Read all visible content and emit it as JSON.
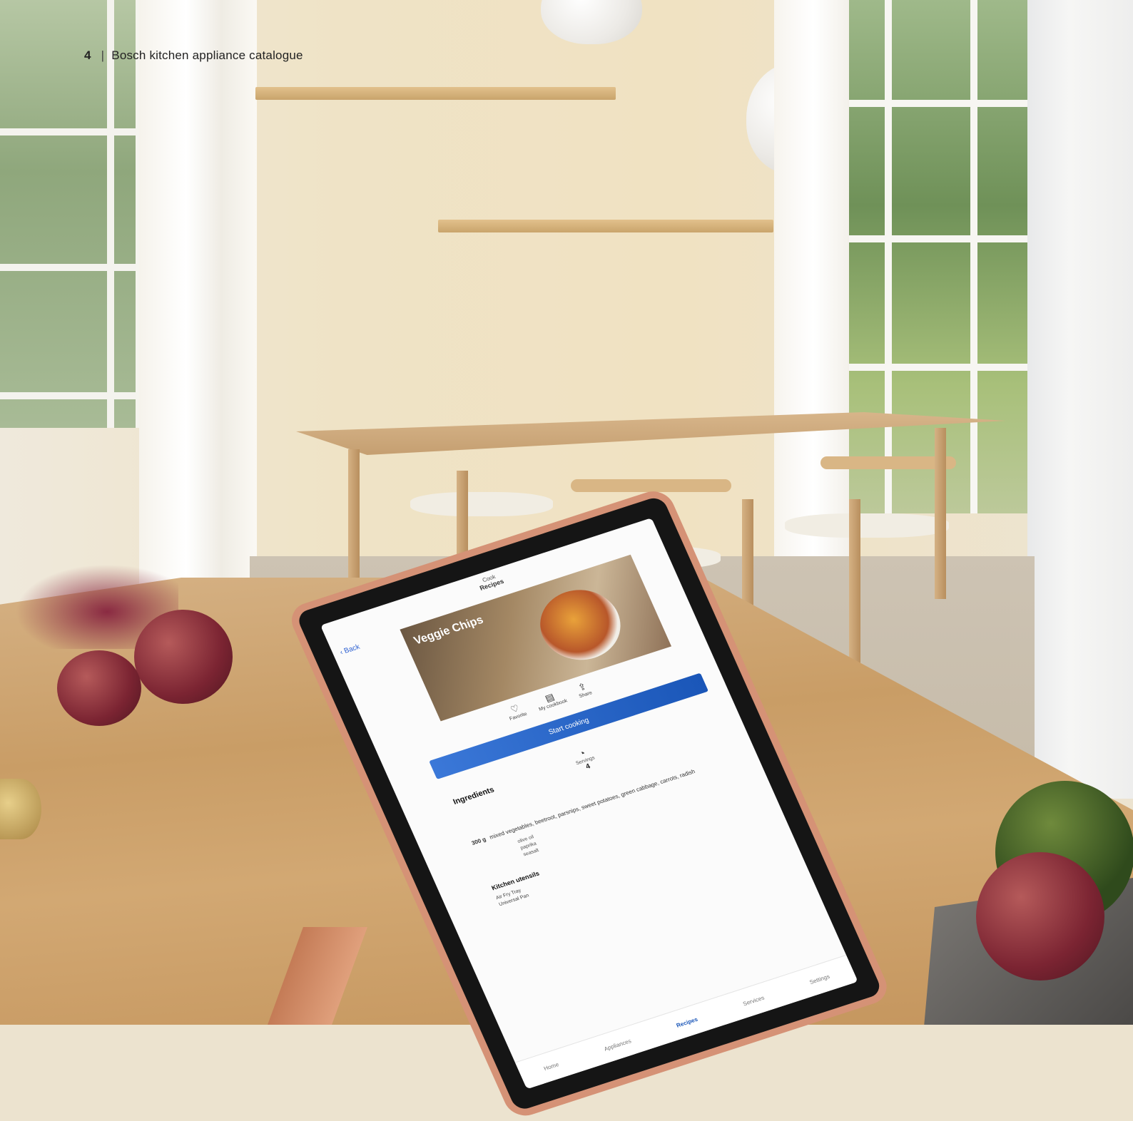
{
  "header": {
    "page_number": "4",
    "separator": "|",
    "title": "Bosch kitchen appliance catalogue"
  },
  "tablet": {
    "status": {
      "app": "Cook",
      "subtitle": "Recipes"
    },
    "back_label": "Back",
    "recipe_title": "Veggie Chips",
    "actions": [
      {
        "icon": "heart-icon",
        "label": "Favorite"
      },
      {
        "icon": "cookbook-icon",
        "label": "My cookbook"
      },
      {
        "icon": "share-icon",
        "label": "Share"
      }
    ],
    "start_button": "Start cooking",
    "ingredients_title": "Ingredients",
    "servings": {
      "label": "Servings",
      "value": "4"
    },
    "ingredient_line": {
      "qty": "300 g",
      "text": "mixed vegetables, beetroot, parsnips, sweet potatoes, green cabbage, carrots, radish"
    },
    "ingredient_extras": [
      "olive oil",
      "paprika",
      "seasalt"
    ],
    "kitchen_title": "Kitchen utensils",
    "kitchen_items": [
      "Air Fry Tray",
      "Universal Pan"
    ],
    "tabs": [
      {
        "label": "Home",
        "active": false
      },
      {
        "label": "Appliances",
        "active": false
      },
      {
        "label": "Recipes",
        "active": true
      },
      {
        "label": "Services",
        "active": false
      },
      {
        "label": "Settings",
        "active": false
      }
    ]
  },
  "colors": {
    "accent": "#1a56b8",
    "tablet_case": "#d59276"
  }
}
